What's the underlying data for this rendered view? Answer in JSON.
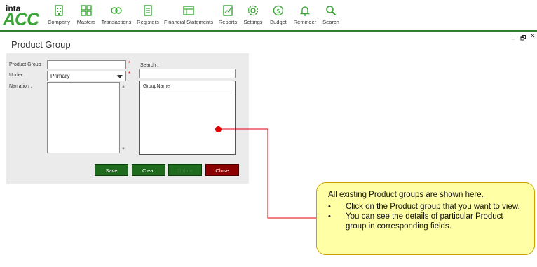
{
  "app": {
    "logo_top": "inta",
    "logo_main": "ACC"
  },
  "nav": {
    "items": [
      {
        "label": "Company",
        "icon": "building-icon"
      },
      {
        "label": "Masters",
        "icon": "boxes-icon"
      },
      {
        "label": "Transactions",
        "icon": "money-exchange-icon"
      },
      {
        "label": "Registers",
        "icon": "register-book-icon"
      },
      {
        "label": "Financial Statements",
        "icon": "statement-icon"
      },
      {
        "label": "Reports",
        "icon": "report-chart-icon"
      },
      {
        "label": "Settings",
        "icon": "gear-icon"
      },
      {
        "label": "Budget",
        "icon": "budget-coin-icon"
      },
      {
        "label": "Reminder",
        "icon": "bell-icon"
      },
      {
        "label": "Search",
        "icon": "search-icon"
      }
    ]
  },
  "window": {
    "minimize": "_",
    "restore": "🗗",
    "close": "✕"
  },
  "page": {
    "title": "Product Group"
  },
  "form": {
    "product_group_label": "Product Group :",
    "product_group_value": "",
    "under_label": "Under :",
    "under_value": "Primary",
    "narration_label": "Narration :",
    "narration_value": "",
    "required_mark": "*",
    "search_label": "Search :",
    "search_value": "",
    "grid_header": "GroupName"
  },
  "buttons": {
    "save": "Save",
    "clear": "Clear",
    "delete": "Delete",
    "close": "Close"
  },
  "colors": {
    "accent_green": "#2e7d32",
    "save_green": "#1e6b1e",
    "close_red": "#8b0000",
    "callout_bg": "#ffffa6",
    "pointer_red": "#e00000"
  },
  "callout": {
    "heading": "All existing Product groups are shown here.",
    "bullets": [
      "Click on the Product group that you want to view.",
      "You can see the details of particular Product group in corresponding fields."
    ]
  }
}
